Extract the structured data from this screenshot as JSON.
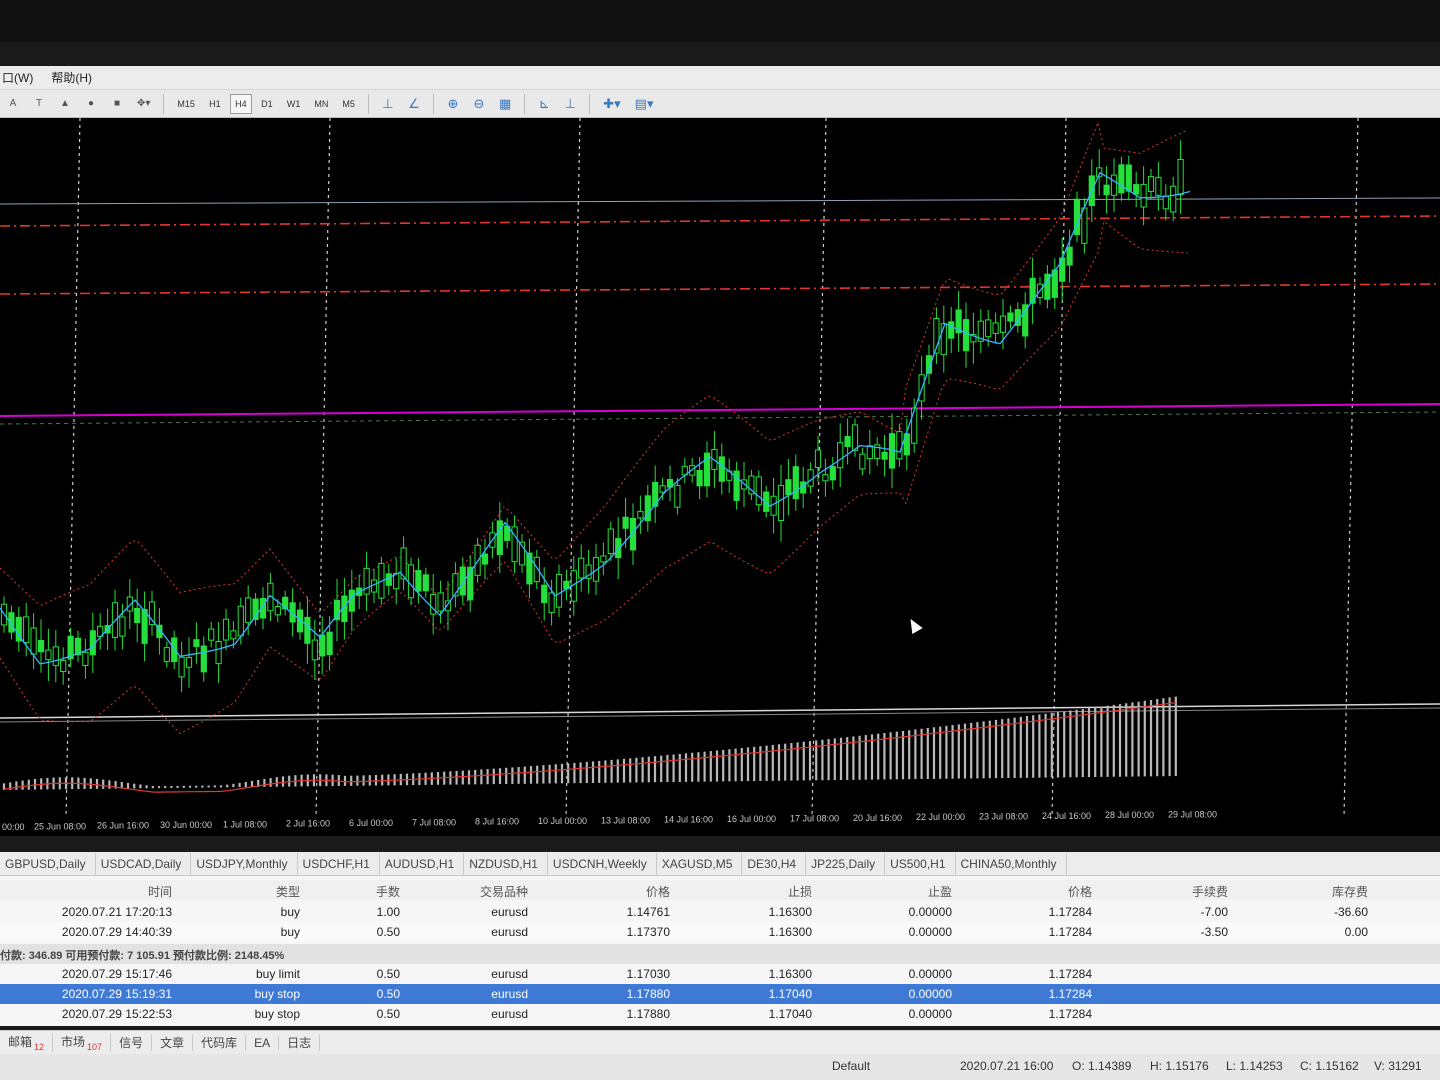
{
  "menu": [
    "口(W)",
    "帮助(H)"
  ],
  "toolbar": {
    "timeframes": [
      "M15",
      "H1",
      "H4",
      "D1",
      "W1",
      "MN",
      "M5"
    ],
    "active_timeframe": "H4"
  },
  "chart": {
    "up_color": "#25e03a",
    "ma_color": "#31b6ff",
    "band_color": "#e0372f",
    "hline_color": "#d600d6",
    "date_labels": [
      "00:00",
      "25 Jun 08:00",
      "26 Jun 16:00",
      "30 Jun 00:00",
      "1 Jul 08:00",
      "2 Jul 16:00",
      "6 Jul 00:00",
      "7 Jul 08:00",
      "8 Jul 16:00",
      "10 Jul 00:00",
      "13 Jul 08:00",
      "14 Jul 16:00",
      "16 Jul 00:00",
      "17 Jul 08:00",
      "20 Jul 16:00",
      "22 Jul 00:00",
      "23 Jul 08:00",
      "24 Jul 16:00",
      "28 Jul 00:00",
      "29 Jul 08:00"
    ]
  },
  "symbol_tabs": [
    "GBPUSD,Daily",
    "USDCAD,Daily",
    "USDJPY,Monthly",
    "USDCHF,H1",
    "AUDUSD,H1",
    "NZDUSD,H1",
    "USDCNH,Weekly",
    "XAGUSD,M5",
    "DE30,H4",
    "JP225,Daily",
    "US500,H1",
    "CHINA50,Monthly"
  ],
  "trade": {
    "headers": {
      "time": "时间",
      "type": "类型",
      "lots": "手数",
      "symbol": "交易品种",
      "price": "价格",
      "sl": "止损",
      "tp": "止盈",
      "cur_price": "价格",
      "commission": "手续费",
      "swap": "库存费"
    },
    "positions": [
      {
        "time": "2020.07.21 17:20:13",
        "type": "buy",
        "lots": "1.00",
        "symbol": "eurusd",
        "price": "1.14761",
        "sl": "1.16300",
        "tp": "0.00000",
        "cur_price": "1.17284",
        "commission": "-7.00",
        "swap": "-36.60"
      },
      {
        "time": "2020.07.29 14:40:39",
        "type": "buy",
        "lots": "0.50",
        "symbol": "eurusd",
        "price": "1.17370",
        "sl": "1.16300",
        "tp": "0.00000",
        "cur_price": "1.17284",
        "commission": "-3.50",
        "swap": "0.00"
      }
    ],
    "summary": "付款: 346.89  可用预付款: 7 105.91  预付款比例: 2148.45%",
    "orders": [
      {
        "time": "2020.07.29 15:17:46",
        "type": "buy limit",
        "lots": "0.50",
        "symbol": "eurusd",
        "price": "1.17030",
        "sl": "1.16300",
        "tp": "0.00000",
        "cur_price": "1.17284",
        "selected": false
      },
      {
        "time": "2020.07.29 15:19:31",
        "type": "buy stop",
        "lots": "0.50",
        "symbol": "eurusd",
        "price": "1.17880",
        "sl": "1.17040",
        "tp": "0.00000",
        "cur_price": "1.17284",
        "selected": true
      },
      {
        "time": "2020.07.29 15:22:53",
        "type": "buy stop",
        "lots": "0.50",
        "symbol": "eurusd",
        "price": "1.17880",
        "sl": "1.17040",
        "tp": "0.00000",
        "cur_price": "1.17284",
        "selected": false
      }
    ]
  },
  "bottom_tabs": [
    {
      "label": "邮箱",
      "badge": "12"
    },
    {
      "label": "市场",
      "badge": "107"
    },
    {
      "label": "信号",
      "badge": ""
    },
    {
      "label": "文章",
      "badge": ""
    },
    {
      "label": "代码库",
      "badge": ""
    },
    {
      "label": "EA",
      "badge": ""
    },
    {
      "label": "日志",
      "badge": ""
    }
  ],
  "status": {
    "profile": "Default",
    "datetime": "2020.07.21 16:00",
    "open": "O: 1.14389",
    "high": "H: 1.15176",
    "low": "L: 1.14253",
    "close": "C: 1.15162",
    "volume": "V: 31291"
  }
}
